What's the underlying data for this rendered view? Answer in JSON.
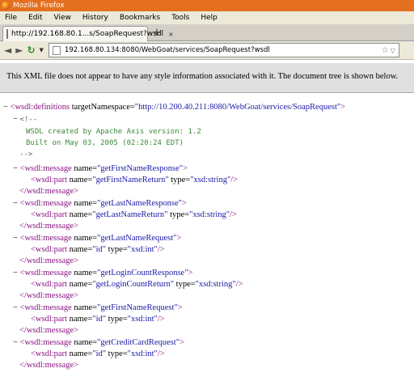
{
  "window": {
    "title": "Mozilla Firefox"
  },
  "menu": [
    "File",
    "Edit",
    "View",
    "History",
    "Bookmarks",
    "Tools",
    "Help"
  ],
  "tab": {
    "label": "http://192.168.80.1...s/SoapRequest?wsdl",
    "close": "×",
    "new_tab": "+"
  },
  "nav": {
    "back": "◄",
    "forward": "►",
    "reload": "↻",
    "dropdown": "▼",
    "url": "192.168.80.134:8080/WebGoat/services/SoapRequest?wsdl",
    "star": "☆",
    "url_dropdown": "▽"
  },
  "infobar": {
    "message": "This XML file does not appear to have any style information associated with it. The document tree is shown below."
  },
  "xml": {
    "root_open": "<wsdl:definitions targetNamespace=\"http://10.200.40.211:8080/WebGoat/services/SoapRequest\">",
    "root_tag": "<wsdl:definitions",
    "root_attr": " targetNamespace=",
    "root_val": "\"http://10.200.40.211:8080/WebGoat/services/SoapRequest\"",
    "root_close": ">",
    "comment_open": "<!--",
    "comment_lines": [
      "WSDL created by Apache Axis version: 1.2",
      "Built on May 03, 2005 (02:20:24 EDT)"
    ],
    "comment_close": "-->",
    "collapse": "−",
    "messages": [
      {
        "name": "getFirstNameResponse",
        "part_name": "getFirstNameReturn",
        "part_type": "xsd:string"
      },
      {
        "name": "getLastNameResponse",
        "part_name": "getLastNameReturn",
        "part_type": "xsd:string"
      },
      {
        "name": "getLastNameRequest",
        "part_name": "id",
        "part_type": "xsd:int"
      },
      {
        "name": "getLoginCountResponse",
        "part_name": "getLoginCountReturn",
        "part_type": "xsd:string"
      },
      {
        "name": "getFirstNameRequest",
        "part_name": "id",
        "part_type": "xsd:int"
      },
      {
        "name": "getCreditCardRequest",
        "part_name": "id",
        "part_type": "xsd:int"
      }
    ],
    "msg_open_tag": "<wsdl:message",
    "msg_name_attr": " name=",
    "part_tag": "<wsdl:part",
    "part_name_attr": " name=",
    "part_type_attr": " type=",
    "self_close": "/>",
    "gt": ">",
    "msg_close": "</wsdl:message>"
  }
}
